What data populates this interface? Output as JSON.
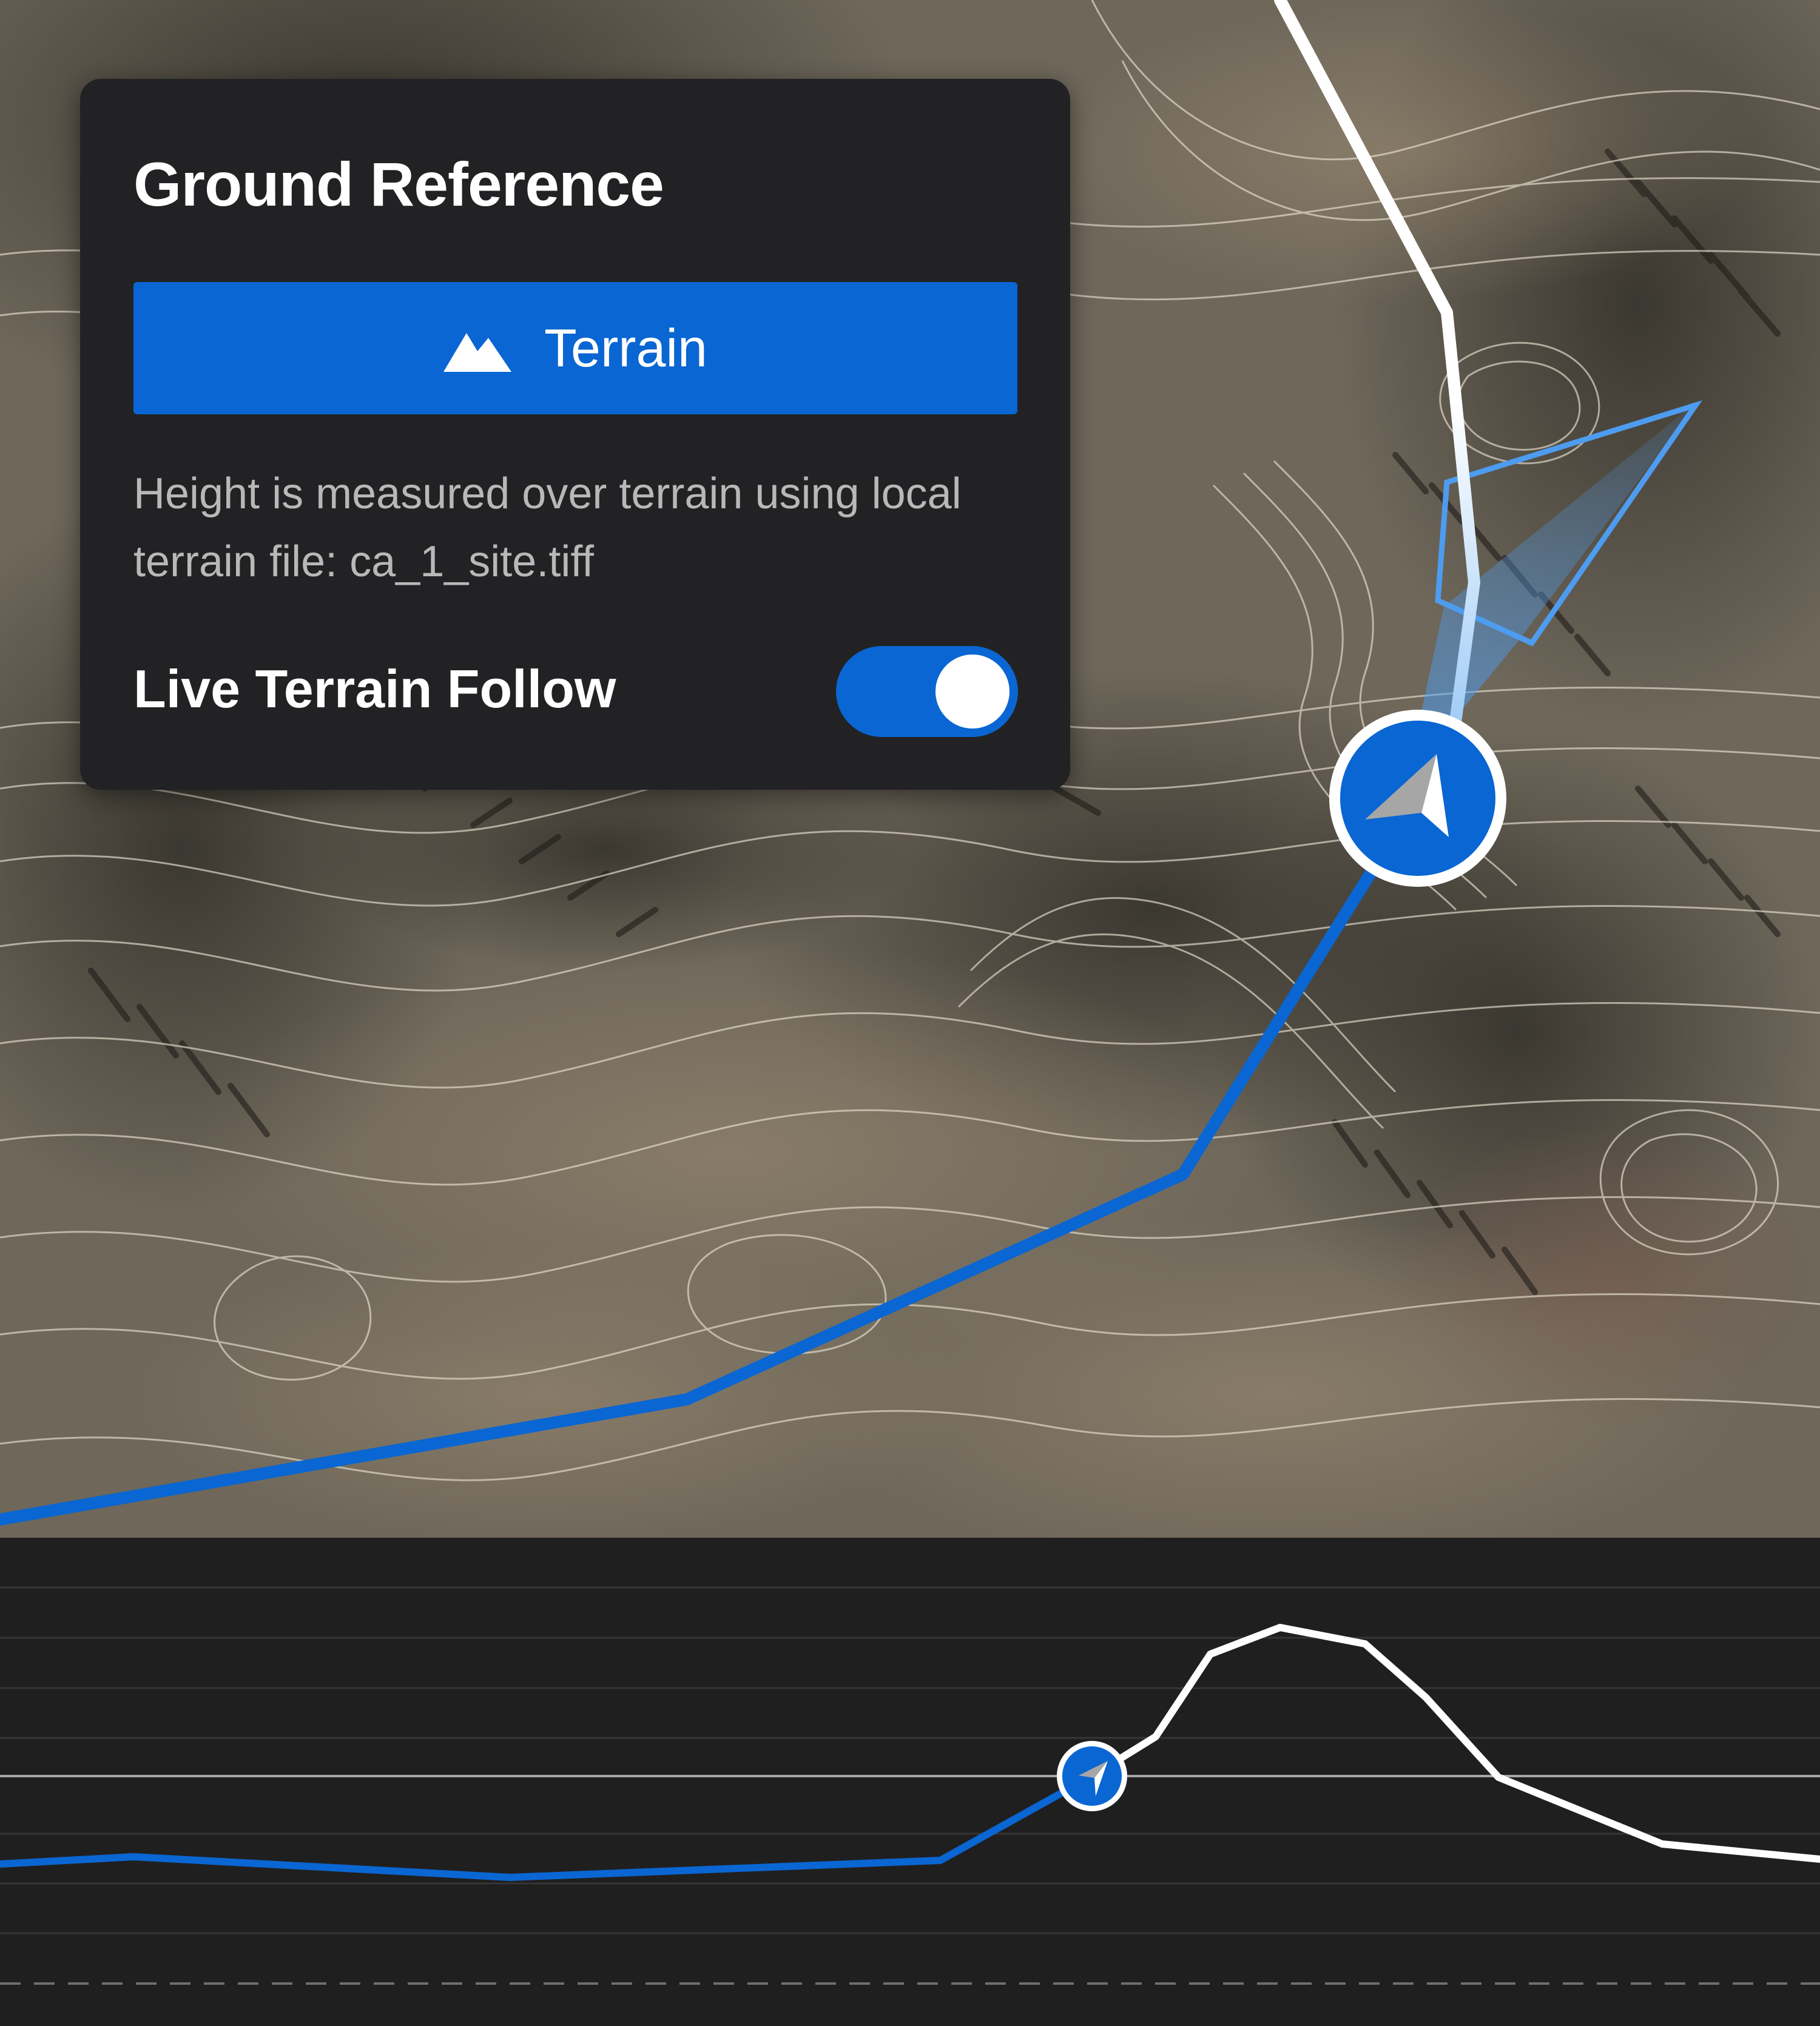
{
  "panel": {
    "title": "Ground Reference",
    "terrain_button": {
      "label": "Terrain",
      "icon": "mountain-icon",
      "active": true
    },
    "description": "Height is measured over terrain using local terrain file: ca_1_site.tiff",
    "live_follow": {
      "label": "Live Terrain Follow",
      "enabled": true
    }
  },
  "map": {
    "type": "satellite-terrain",
    "overlays": [
      "contour-lines",
      "flight-path",
      "aircraft-marker",
      "view-cone",
      "waypoint-polygon"
    ],
    "colors": {
      "flown_path": "#0a66d2",
      "planned_path": "#ffffff",
      "marker_fill": "#0a66d2",
      "marker_ring": "#ffffff",
      "contour": "#e8e0d0",
      "cone": "#4d9cf0"
    }
  },
  "profile": {
    "colors": {
      "flown": "#0a66d2",
      "planned": "#ffffff",
      "grid": "#3a3a3a",
      "reference": "#aaaaaa"
    }
  }
}
